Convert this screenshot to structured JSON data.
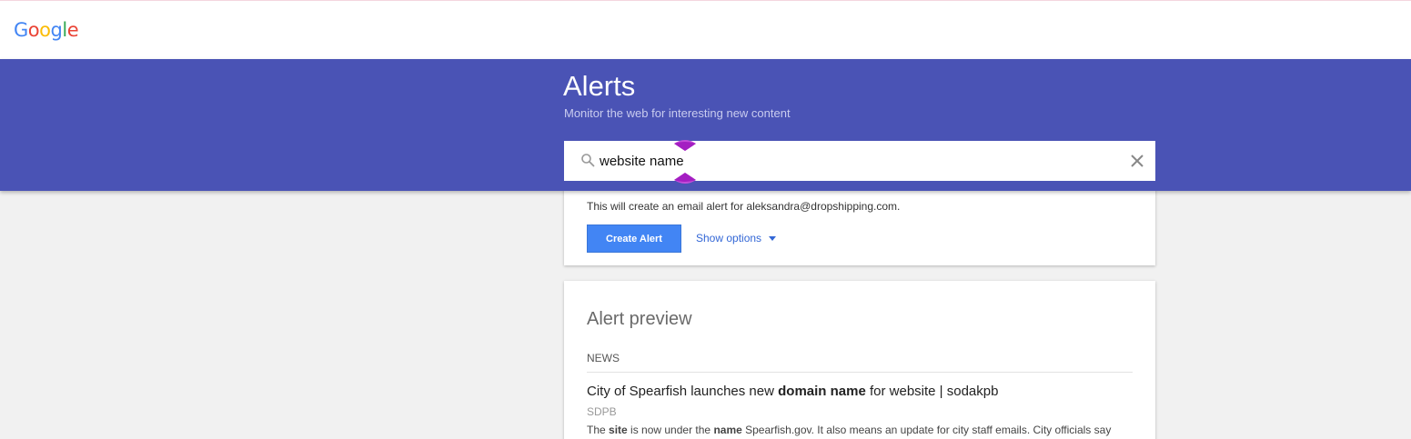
{
  "logo": {
    "letters": [
      {
        "ch": "G",
        "color": "#4285f4"
      },
      {
        "ch": "o",
        "color": "#ea4335"
      },
      {
        "ch": "o",
        "color": "#fbbc05"
      },
      {
        "ch": "g",
        "color": "#4285f4"
      },
      {
        "ch": "l",
        "color": "#34a853"
      },
      {
        "ch": "e",
        "color": "#ea4335"
      }
    ]
  },
  "header": {
    "title": "Alerts",
    "subtitle": "Monitor the web for interesting new content",
    "banner_color": "#4a53b5"
  },
  "search": {
    "value": "website name",
    "icon": "search-icon",
    "clear_icon": "close-icon"
  },
  "create_card": {
    "email_note": "This will create an email alert for aleksandra@dropshipping.com.",
    "create_button_label": "Create Alert",
    "show_options_label": "Show options",
    "accent_color": "#4285f4"
  },
  "preview": {
    "title": "Alert preview",
    "section": "NEWS",
    "article": {
      "title_parts": [
        {
          "text": "City of Spearfish launches new ",
          "bold": false
        },
        {
          "text": "domain name",
          "bold": true
        },
        {
          "text": " for website | sodakpb",
          "bold": false
        }
      ],
      "source": "SDPB",
      "snippet_parts": [
        {
          "text": "The ",
          "bold": false
        },
        {
          "text": "site",
          "bold": true
        },
        {
          "text": " is now under the ",
          "bold": false
        },
        {
          "text": "name",
          "bold": true
        },
        {
          "text": " Spearfish.gov. It also means an update for city staff emails. City officials say",
          "bold": false
        }
      ]
    }
  }
}
